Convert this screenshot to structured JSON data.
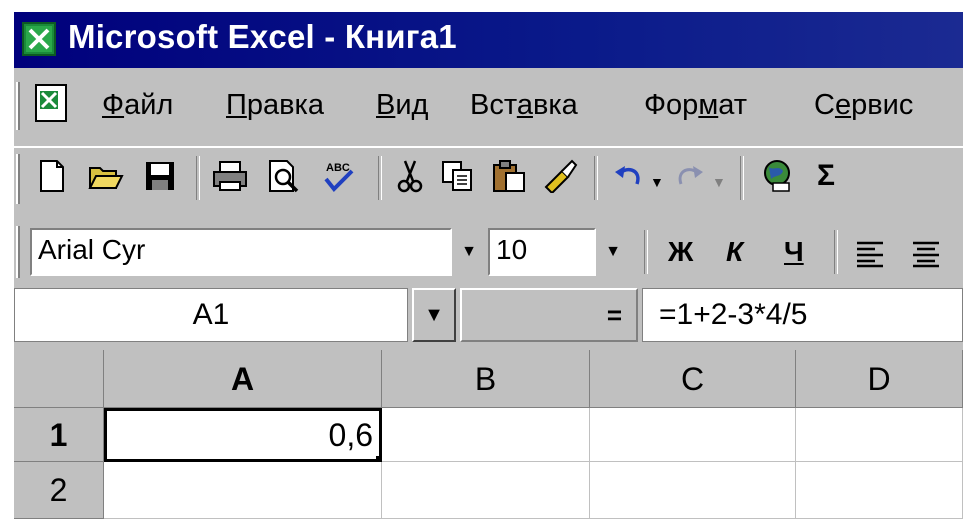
{
  "window": {
    "title": "Microsoft Excel - Книга1"
  },
  "menu": {
    "items": [
      {
        "label_pre": "",
        "label_u": "Ф",
        "label_post": "айл"
      },
      {
        "label_pre": "",
        "label_u": "П",
        "label_post": "равка"
      },
      {
        "label_pre": "",
        "label_u": "В",
        "label_post": "ид"
      },
      {
        "label_pre": "Вст",
        "label_u": "а",
        "label_post": "вка"
      },
      {
        "label_pre": "Фор",
        "label_u": "м",
        "label_post": "ат"
      },
      {
        "label_pre": "С",
        "label_u": "е",
        "label_post": "рвис"
      }
    ]
  },
  "toolbar": {
    "icons": [
      "new-document-icon",
      "open-folder-icon",
      "save-icon",
      "print-icon",
      "print-preview-icon",
      "spelling-icon",
      "cut-icon",
      "copy-icon",
      "paste-icon",
      "format-painter-icon",
      "undo-icon",
      "redo-icon",
      "web-icon",
      "autosum-icon"
    ],
    "autosum_glyph": "Σ"
  },
  "format": {
    "font_name": "Arial Cyr",
    "font_size": "10",
    "bold": "Ж",
    "italic": "К",
    "underline": "Ч"
  },
  "formula_bar": {
    "name_box": "A1",
    "equals": "=",
    "formula": "=1+2-3*4/5"
  },
  "sheet": {
    "columns": [
      "A",
      "B",
      "C",
      "D"
    ],
    "rows": [
      "1",
      "2"
    ],
    "cells": {
      "A1": "0,6"
    },
    "selected_cell": "A1"
  },
  "colors": {
    "title_bar": "#00007c",
    "chrome": "#c0c0c0"
  }
}
